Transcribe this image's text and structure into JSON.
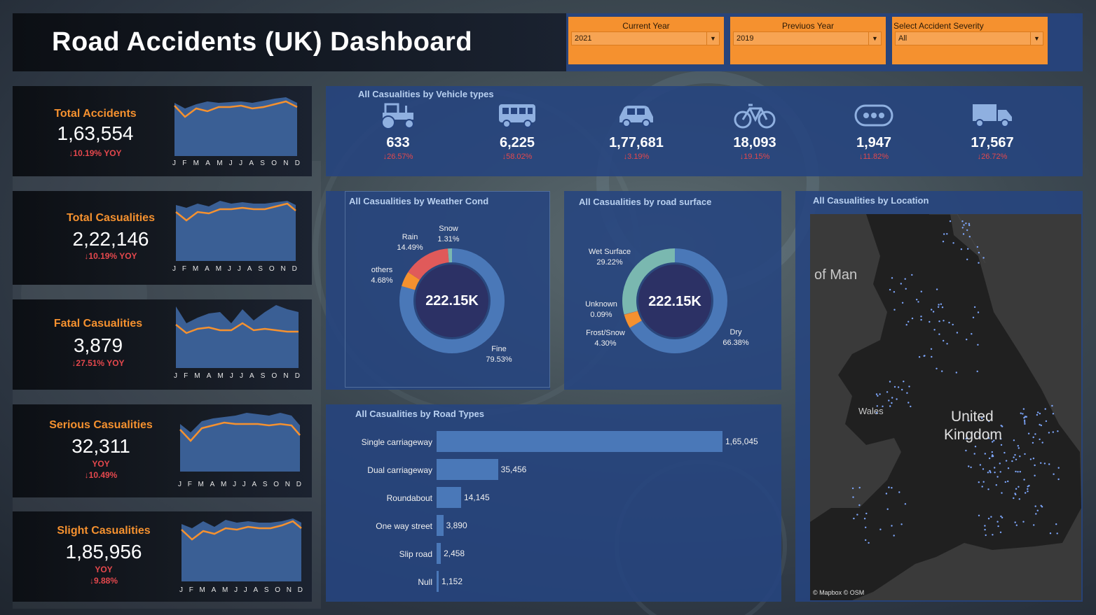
{
  "header": {
    "title": "Road Accidents (UK) Dashboard",
    "filters": [
      {
        "label": "Current Year",
        "value": "2021"
      },
      {
        "label": "Previuos Year",
        "value": "2019"
      },
      {
        "label": "Select Accident Severity",
        "value": "All"
      }
    ]
  },
  "kpis": [
    {
      "label": "Total Accidents",
      "value": "1,63,554",
      "yoy": "↓10.19% YOY"
    },
    {
      "label": "Total Casualities",
      "value": "2,22,146",
      "yoy": "↓10.19% YOY"
    },
    {
      "label": "Fatal Casualities",
      "value": "3,879",
      "yoy": "↓27.51% YOY"
    },
    {
      "label": "Serious Casualities",
      "value": "32,311",
      "yoy_label": "YOY",
      "yoy": "↓10.49%"
    },
    {
      "label": "Slight Casualities",
      "value": "1,85,956",
      "yoy_label": "YOY",
      "yoy": "↓9.88%"
    }
  ],
  "months": [
    "J",
    "F",
    "M",
    "A",
    "M",
    "J",
    "J",
    "A",
    "S",
    "O",
    "N",
    "D"
  ],
  "vehicles": {
    "title": "All Casualities by Vehicle types",
    "items": [
      {
        "icon": "tractor-icon",
        "value": "633",
        "change": "↓26.57%"
      },
      {
        "icon": "bus-icon",
        "value": "6,225",
        "change": "↓58.02%"
      },
      {
        "icon": "car-icon",
        "value": "1,77,681",
        "change": "↓3.19%"
      },
      {
        "icon": "bicycle-icon",
        "value": "18,093",
        "change": "↓19.15%"
      },
      {
        "icon": "other-vehicle-icon",
        "value": "1,947",
        "change": "↓11.82%"
      },
      {
        "icon": "truck-icon",
        "value": "17,567",
        "change": "↓26.72%"
      }
    ]
  },
  "weather": {
    "title": "All Casualities by Weather Cond",
    "center": "222.15K",
    "labels": {
      "snow": [
        "Snow",
        "1.31%"
      ],
      "rain": [
        "Rain",
        "14.49%"
      ],
      "others": [
        "others",
        "4.68%"
      ],
      "fine": [
        "Fine",
        "79.53%"
      ]
    }
  },
  "surface": {
    "title": "All Casualities by road surface",
    "center": "222.15K",
    "labels": {
      "wet": [
        "Wet Surface",
        "29.22%"
      ],
      "unknown": [
        "Unknown",
        "0.09%"
      ],
      "frost": [
        "Frost/Snow",
        "4.30%"
      ],
      "dry": [
        "Dry",
        "66.38%"
      ]
    }
  },
  "roads": {
    "title": "All Casualities by Road Types",
    "items": [
      {
        "label": "Single carriageway",
        "value": "1,65,045"
      },
      {
        "label": "Dual carriageway",
        "value": "35,456"
      },
      {
        "label": "Roundabout",
        "value": "14,145"
      },
      {
        "label": "One way street",
        "value": "3,890"
      },
      {
        "label": "Slip road",
        "value": "2,458"
      },
      {
        "label": "Null",
        "value": "1,152"
      }
    ]
  },
  "map": {
    "title": "All Casualities by Location",
    "label_isle": "of Man",
    "label_wales": "Wales",
    "label_uk1": "United",
    "label_uk2": "Kingdom",
    "attribution": "© Mapbox © OSM"
  },
  "chart_data": [
    {
      "type": "pie",
      "title": "All Casualities by Weather Cond",
      "categories": [
        "Fine",
        "Rain",
        "others",
        "Snow"
      ],
      "values": [
        79.53,
        14.49,
        4.68,
        1.31
      ],
      "colors": [
        "#4a78b8",
        "#e05a5a",
        "#f5912f",
        "#7ab8b0"
      ]
    },
    {
      "type": "pie",
      "title": "All Casualities by road surface",
      "categories": [
        "Dry",
        "Wet Surface",
        "Frost/Snow",
        "Unknown"
      ],
      "values": [
        66.38,
        29.22,
        4.3,
        0.09
      ],
      "colors": [
        "#4a78b8",
        "#7ab8b0",
        "#f5912f",
        "#e05a5a"
      ]
    },
    {
      "type": "bar",
      "title": "All Casualities by Road Types",
      "categories": [
        "Single carriageway",
        "Dual carriageway",
        "Roundabout",
        "One way street",
        "Slip road",
        "Null"
      ],
      "values": [
        165045,
        35456,
        14145,
        3890,
        2458,
        1152
      ]
    }
  ]
}
